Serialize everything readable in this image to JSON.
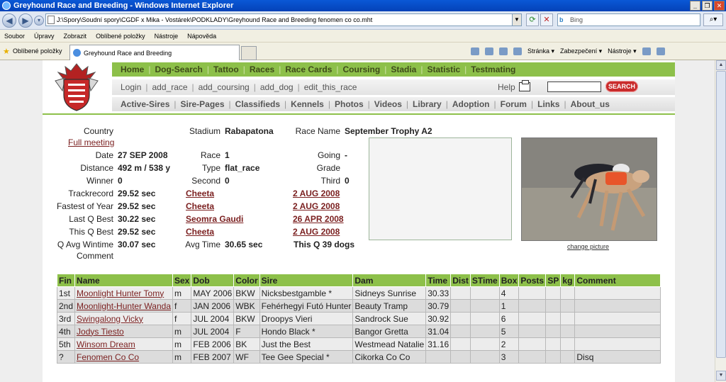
{
  "window": {
    "title": "Greyhound Race and Breeding - Windows Internet Explorer",
    "address": "J:\\Spory\\Soudní spory\\CGDF x Mika - Vostárek\\PODKLADY\\Greyhound Race and Breeding fenomen co co.mht",
    "search_placeholder": "Bing",
    "menu": [
      "Soubor",
      "Úpravy",
      "Zobrazit",
      "Oblíbené položky",
      "Nástroje",
      "Nápověda"
    ],
    "favorites_label": "Oblíbené položky",
    "tab_title": "Greyhound Race and Breeding",
    "cmd": [
      "Stránka ▾",
      "Zabezpečení ▾",
      "Nástroje ▾"
    ]
  },
  "nav": {
    "row1": [
      "Home",
      "Dog-Search",
      "Tattoo",
      "Races",
      "Race Cards",
      "Coursing",
      "Stadia",
      "Statistic",
      "Testmating"
    ],
    "row2": [
      "Login",
      "add_race",
      "add_coursing",
      "add_dog",
      "edit_this_race"
    ],
    "help": "Help",
    "search_button": "SEARCH",
    "row3": [
      "Active-Sires",
      "Sire-Pages",
      "Classifieds",
      "Kennels",
      "Photos",
      "Videos",
      "Library",
      "Adoption",
      "Forum",
      "Links",
      "About_us"
    ]
  },
  "race": {
    "country_label": "Country",
    "full_meeting": "Full meeting",
    "stadium_label": "Stadium",
    "stadium": "Rabapatona",
    "race_name_label": "Race Name",
    "race_name": "September Trophy A2",
    "date_label": "Date",
    "date": "27 SEP 2008",
    "race_label": "Race",
    "race_no": "1",
    "going_label": "Going",
    "going": "-",
    "distance_label": "Distance",
    "distance": "492 m / 538 y",
    "type_label": "Type",
    "type": "flat_race",
    "grade_label": "Grade",
    "winner_label": "Winner",
    "winner": "0",
    "second_label": "Second",
    "second": "0",
    "third_label": "Third",
    "third": "0",
    "trackrecord_label": "Trackrecord",
    "trackrecord": "29.52 sec",
    "trackrecord_dog": "Cheeta",
    "trackrecord_date": "2 AUG 2008",
    "fastest_label": "Fastest of Year",
    "fastest": "29.52 sec",
    "fastest_dog": "Cheeta",
    "fastest_date": "2 AUG 2008",
    "lastq_label": "Last Q Best",
    "lastq": "30.22 sec",
    "lastq_dog": "Seomra Gaudi",
    "lastq_date": "26 APR 2008",
    "thisq_label": "This Q Best",
    "thisq": "29.52 sec",
    "thisq_dog": "Cheeta",
    "thisq_date": "2 AUG 2008",
    "qavg_label": "Q Avg Wintime",
    "qavg": "30.07 sec",
    "avgtime_label": "Avg Time",
    "avgtime": "30.65 sec",
    "thisq_dogs": "This Q 39 dogs",
    "comment_label": "Comment",
    "change_picture": "change picture"
  },
  "results": {
    "headers": [
      "Fin",
      "Name",
      "Sex",
      "Dob",
      "Color",
      "Sire",
      "Dam",
      "Time",
      "Dist",
      "STime",
      "Box",
      "Posts",
      "SP",
      "kg",
      "Comment"
    ],
    "rows": [
      [
        "1st",
        "Moonlight Hunter Tomy",
        "m",
        "MAY 2006",
        "BKW",
        "Nicksbestgamble *",
        "Sidneys Sunrise",
        "30.33",
        "",
        "",
        "4",
        "",
        "",
        "",
        ""
      ],
      [
        "2nd",
        "Moonlight-Hunter Wanda",
        "f",
        "JAN 2006",
        "WBK",
        "Fehérhegyi Futó Hunter",
        "Beauty Tramp",
        "30.79",
        "",
        "",
        "1",
        "",
        "",
        "",
        ""
      ],
      [
        "3rd",
        "Swingalong Vicky",
        "f",
        "JUL 2004",
        "BKW",
        "Droopys Vieri",
        "Sandrock Sue",
        "30.92",
        "",
        "",
        "6",
        "",
        "",
        "",
        ""
      ],
      [
        "4th",
        "Jodys Tiesto",
        "m",
        "JUL 2004",
        "F",
        "Hondo Black *",
        "Bangor Gretta",
        "31.04",
        "",
        "",
        "5",
        "",
        "",
        "",
        ""
      ],
      [
        "5th",
        "Winsom Dream",
        "m",
        "FEB 2006",
        "BK",
        "Just the Best",
        "Westmead Natalie",
        "31.16",
        "",
        "",
        "2",
        "",
        "",
        "",
        ""
      ],
      [
        "?",
        "Fenomen Co Co",
        "m",
        "FEB 2007",
        "WF",
        "Tee Gee Special *",
        "Cikorka Co Co",
        "",
        "",
        "",
        "3",
        "",
        "",
        "",
        "Disq"
      ]
    ]
  },
  "colors": {
    "nav_green": "#8dc04a",
    "link": "#7a1f1f",
    "search_red": "#c92b2b"
  }
}
